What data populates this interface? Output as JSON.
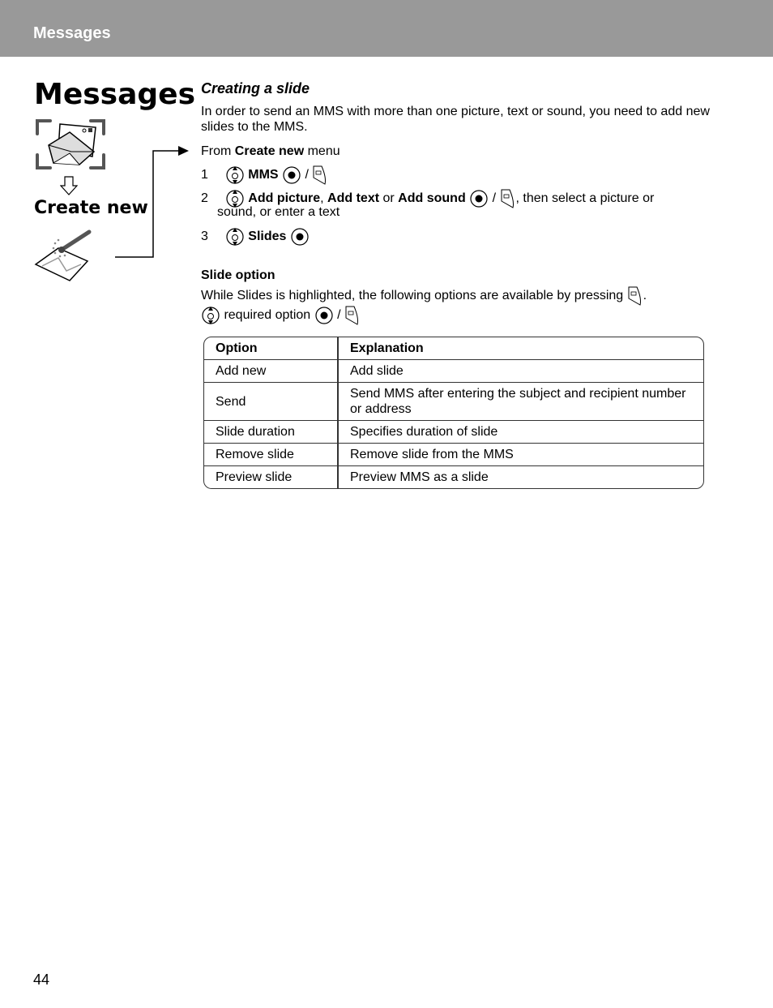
{
  "header": {
    "title": "Messages"
  },
  "sidebar": {
    "title": "Messages",
    "menu_item": "Create new",
    "icons": [
      "messages-envelope-icon",
      "down-arrow-icon",
      "create-new-envelope-icon"
    ]
  },
  "main": {
    "section_title": "Creating a slide",
    "intro": "In order to send an MMS with more than one picture, text or sound, you need to add new slides to the MMS.",
    "from_menu": {
      "prefix": "From ",
      "menu": "Create new",
      "suffix": " menu"
    },
    "steps": [
      {
        "num": "1",
        "bold1": "MMS"
      },
      {
        "num": "2",
        "bold1": "Add picture",
        "sep1": ", ",
        "bold2": "Add text",
        "sep2": " or ",
        "bold3": "Add sound",
        "tail1": ", then select a picture or",
        "tail2": "sound, or enter a text"
      },
      {
        "num": "3",
        "bold1": "Slides"
      }
    ],
    "slash": "/",
    "slide_option": {
      "heading": "Slide option",
      "text": "While Slides is highlighted, the following options are available by pressing",
      "period": ".",
      "instruction": "required option"
    },
    "table": {
      "headers": [
        "Option",
        "Explanation"
      ],
      "rows": [
        [
          "Add new",
          "Add slide"
        ],
        [
          "Send",
          "Send MMS after entering the subject and recipient number or address"
        ],
        [
          "Slide duration",
          "Specifies duration of slide"
        ],
        [
          "Remove slide",
          "Remove slide from the MMS"
        ],
        [
          "Preview slide",
          "Preview MMS as a slide"
        ]
      ]
    }
  },
  "footer": {
    "page_number": "44"
  }
}
